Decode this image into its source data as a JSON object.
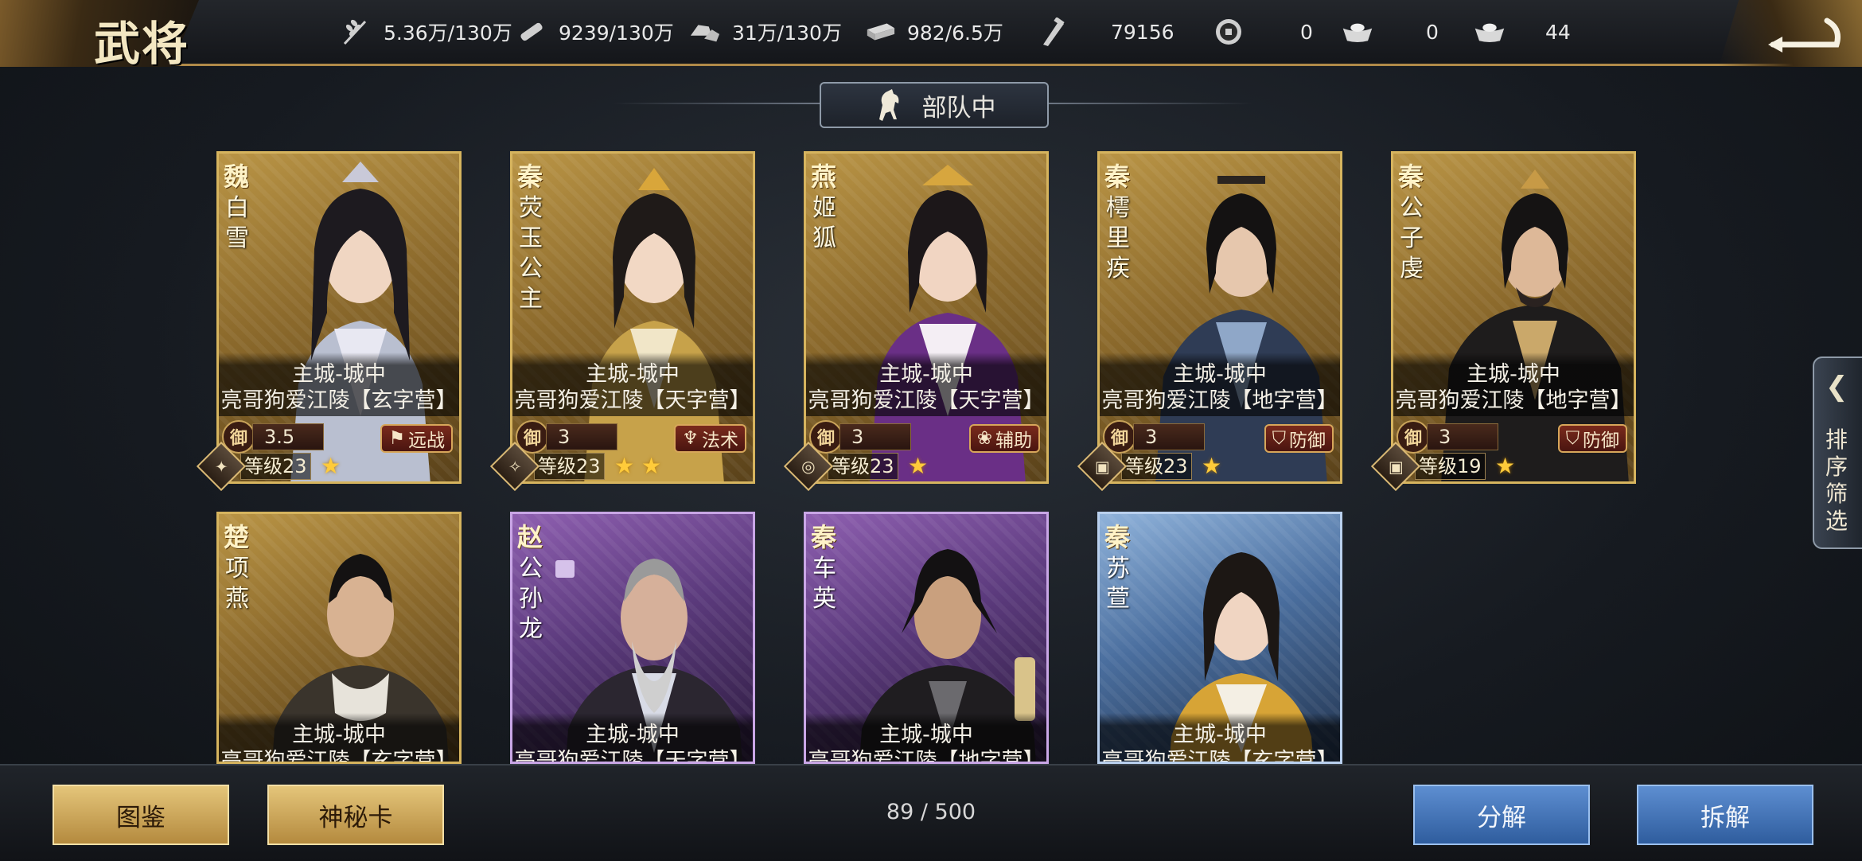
{
  "header": {
    "title": "武将",
    "resources": [
      {
        "icon": "wheat-icon",
        "value": "5.36万/130万"
      },
      {
        "icon": "wood-icon",
        "value": "9239/130万"
      },
      {
        "icon": "stone-icon",
        "value": "31万/130万"
      },
      {
        "icon": "iron-icon",
        "value": "982/6.5万"
      },
      {
        "icon": "order-icon",
        "value": "79156"
      },
      {
        "icon": "coin-icon",
        "value": "0"
      },
      {
        "icon": "gold-ingot-icon",
        "value": "0"
      },
      {
        "icon": "silver-ingot-icon",
        "value": "44"
      }
    ]
  },
  "section": {
    "title": "部队中"
  },
  "cards": [
    {
      "nation": "魏",
      "name": "白雪",
      "location": "主城-城中",
      "army": "亮哥狗爱江陵【玄字营】",
      "defense_label": "御",
      "defense": "3.5",
      "role": "远战",
      "level": "等级23",
      "stars": 1,
      "type_icon": "cavalry-icon"
    },
    {
      "nation": "秦",
      "name": "荧玉公主",
      "location": "主城-城中",
      "army": "亮哥狗爱江陵【天字营】",
      "defense_label": "御",
      "defense": "3",
      "role": "法术",
      "level": "等级23",
      "stars": 2,
      "type_icon": "spear-icon"
    },
    {
      "nation": "燕",
      "name": "姬狐",
      "location": "主城-城中",
      "army": "亮哥狗爱江陵【天字营】",
      "defense_label": "御",
      "defense": "3",
      "role": "辅助",
      "level": "等级23",
      "stars": 1,
      "type_icon": "archer-icon"
    },
    {
      "nation": "秦",
      "name": "樗里疾",
      "location": "主城-城中",
      "army": "亮哥狗爱江陵【地字营】",
      "defense_label": "御",
      "defense": "3",
      "role": "防御",
      "level": "等级23",
      "stars": 1,
      "type_icon": "infantry-icon"
    },
    {
      "nation": "秦",
      "name": "公子虔",
      "location": "主城-城中",
      "army": "亮哥狗爱江陵【地字营】",
      "defense_label": "御",
      "defense": "3",
      "role": "防御",
      "level": "等级19",
      "stars": 1,
      "type_icon": "infantry-icon"
    },
    {
      "nation": "楚",
      "name": "项燕",
      "location": "主城-城中",
      "army": "亮哥狗爱江陵【玄字营】"
    },
    {
      "nation": "赵",
      "name": "公孙龙",
      "location": "主城-城中",
      "army": "亮哥狗爱江陵【天字营】"
    },
    {
      "nation": "秦",
      "name": "车英",
      "location": "主城-城中",
      "army": "亮哥狗爱江陵【地字营】"
    },
    {
      "nation": "秦",
      "name": "苏萱",
      "location": "主城-城中",
      "army": "亮哥狗爱江陵【玄字营】"
    }
  ],
  "sort_tab": {
    "label": "排序筛选"
  },
  "footer": {
    "catalog_label": "图鉴",
    "mystery_label": "神秘卡",
    "count": "89 / 500",
    "decompose_label": "分解",
    "dismantle_label": "拆解"
  }
}
